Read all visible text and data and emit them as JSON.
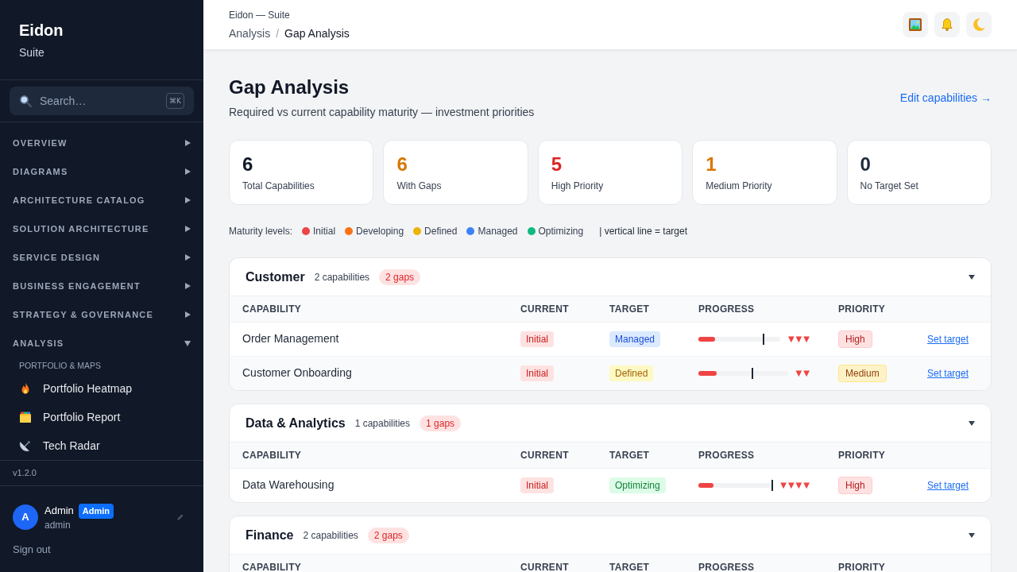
{
  "sidebar": {
    "brand": {
      "title": "Eidon",
      "subtitle": "Suite"
    },
    "search": {
      "placeholder": "Search…",
      "shortcut": "⌘K"
    },
    "sections": [
      {
        "label": "OVERVIEW",
        "expanded": false
      },
      {
        "label": "DIAGRAMS",
        "expanded": false
      },
      {
        "label": "ARCHITECTURE CATALOG",
        "expanded": false
      },
      {
        "label": "SOLUTION ARCHITECTURE",
        "expanded": false
      },
      {
        "label": "SERVICE DESIGN",
        "expanded": false
      },
      {
        "label": "BUSINESS ENGAGEMENT",
        "expanded": false
      },
      {
        "label": "STRATEGY & GOVERNANCE",
        "expanded": false
      },
      {
        "label": "ANALYSIS",
        "expanded": true,
        "groups": [
          {
            "heading": "PORTFOLIO & MAPS",
            "items": [
              {
                "label": "Portfolio Heatmap",
                "kind": "heatmap",
                "selected": false
              },
              {
                "label": "Portfolio Report",
                "kind": "report",
                "selected": false
              },
              {
                "label": "Tech Radar",
                "kind": "radar",
                "selected": false
              }
            ]
          }
        ]
      }
    ],
    "version": "v1.2.0",
    "user": {
      "initial": "A",
      "name": "Admin",
      "role": "Admin",
      "username": "admin"
    },
    "sign_out": "Sign out"
  },
  "header": {
    "app": "Eidon — Suite",
    "breadcrumb": {
      "items": [
        "Analysis",
        "Gap Analysis"
      ],
      "separator": "/"
    },
    "actions": [
      {
        "kind": "gallery"
      },
      {
        "kind": "notifications"
      },
      {
        "kind": "theme"
      }
    ]
  },
  "page": {
    "title": "Gap Analysis",
    "subtitle": "Required vs current capability maturity — investment priorities",
    "link": "Edit capabilities →"
  },
  "stats": [
    {
      "value": "6",
      "label": "Total Capabilities",
      "color": "#111827"
    },
    {
      "value": "6",
      "label": "With Gaps",
      "color": "#d97706"
    },
    {
      "value": "5",
      "label": "High Priority",
      "color": "#dc2626"
    },
    {
      "value": "1",
      "label": "Medium Priority",
      "color": "#d97706"
    },
    {
      "value": "0",
      "label": "No Target Set",
      "color": "#1e293b"
    }
  ],
  "legend": {
    "label": "Maturity levels:",
    "levels": [
      {
        "label": "Initial",
        "color": "#ef4444"
      },
      {
        "label": "Developing",
        "color": "#f97316"
      },
      {
        "label": "Defined",
        "color": "#eab308"
      },
      {
        "label": "Managed",
        "color": "#3b82f6"
      },
      {
        "label": "Optimizing",
        "color": "#10b981"
      }
    ],
    "note": "| vertical line = target"
  },
  "groups": [
    {
      "name": "Customer",
      "count": "2 capabilities",
      "gaps": "2 gaps",
      "expanded": true,
      "columns": [
        "CAPABILITY",
        "CURRENT",
        "TARGET",
        "PROGRESS",
        "PRIORITY"
      ],
      "rows": [
        {
          "capability": "Order Management",
          "current": {
            "text": "Initial",
            "kind": "initial"
          },
          "target": {
            "text": "Managed",
            "kind": "managed"
          },
          "progress": {
            "level": 0.2,
            "target": {
              "level": 0.8
            },
            "gap_marks": "▼▼▼"
          },
          "priority": {
            "text": "High",
            "kind": "high"
          },
          "action": "Set target"
        },
        {
          "capability": "Customer Onboarding",
          "current": {
            "text": "Initial",
            "kind": "initial"
          },
          "target": {
            "text": "Defined",
            "kind": "defined"
          },
          "progress": {
            "level": 0.2,
            "target": {
              "level": 0.6
            },
            "gap_marks": "▼▼"
          },
          "priority": {
            "text": "Medium",
            "kind": "medium"
          },
          "action": "Set target"
        }
      ]
    },
    {
      "name": "Data & Analytics",
      "count": "1 capabilities",
      "gaps": "1 gaps",
      "expanded": true,
      "columns": [
        "CAPABILITY",
        "CURRENT",
        "TARGET",
        "PROGRESS",
        "PRIORITY"
      ],
      "rows": [
        {
          "capability": "Data Warehousing",
          "current": {
            "text": "Initial",
            "kind": "initial"
          },
          "target": {
            "text": "Optimizing",
            "kind": "optimizing"
          },
          "progress": {
            "level": 0.2,
            "target": {
              "level": 1.0
            },
            "gap_marks": "▼▼▼▼"
          },
          "priority": {
            "text": "High",
            "kind": "high"
          },
          "action": "Set target"
        }
      ]
    },
    {
      "name": "Finance",
      "count": "2 capabilities",
      "gaps": "2 gaps",
      "expanded": true,
      "columns": [
        "CAPABILITY",
        "CURRENT",
        "TARGET",
        "PROGRESS",
        "PRIORITY"
      ]
    }
  ]
}
